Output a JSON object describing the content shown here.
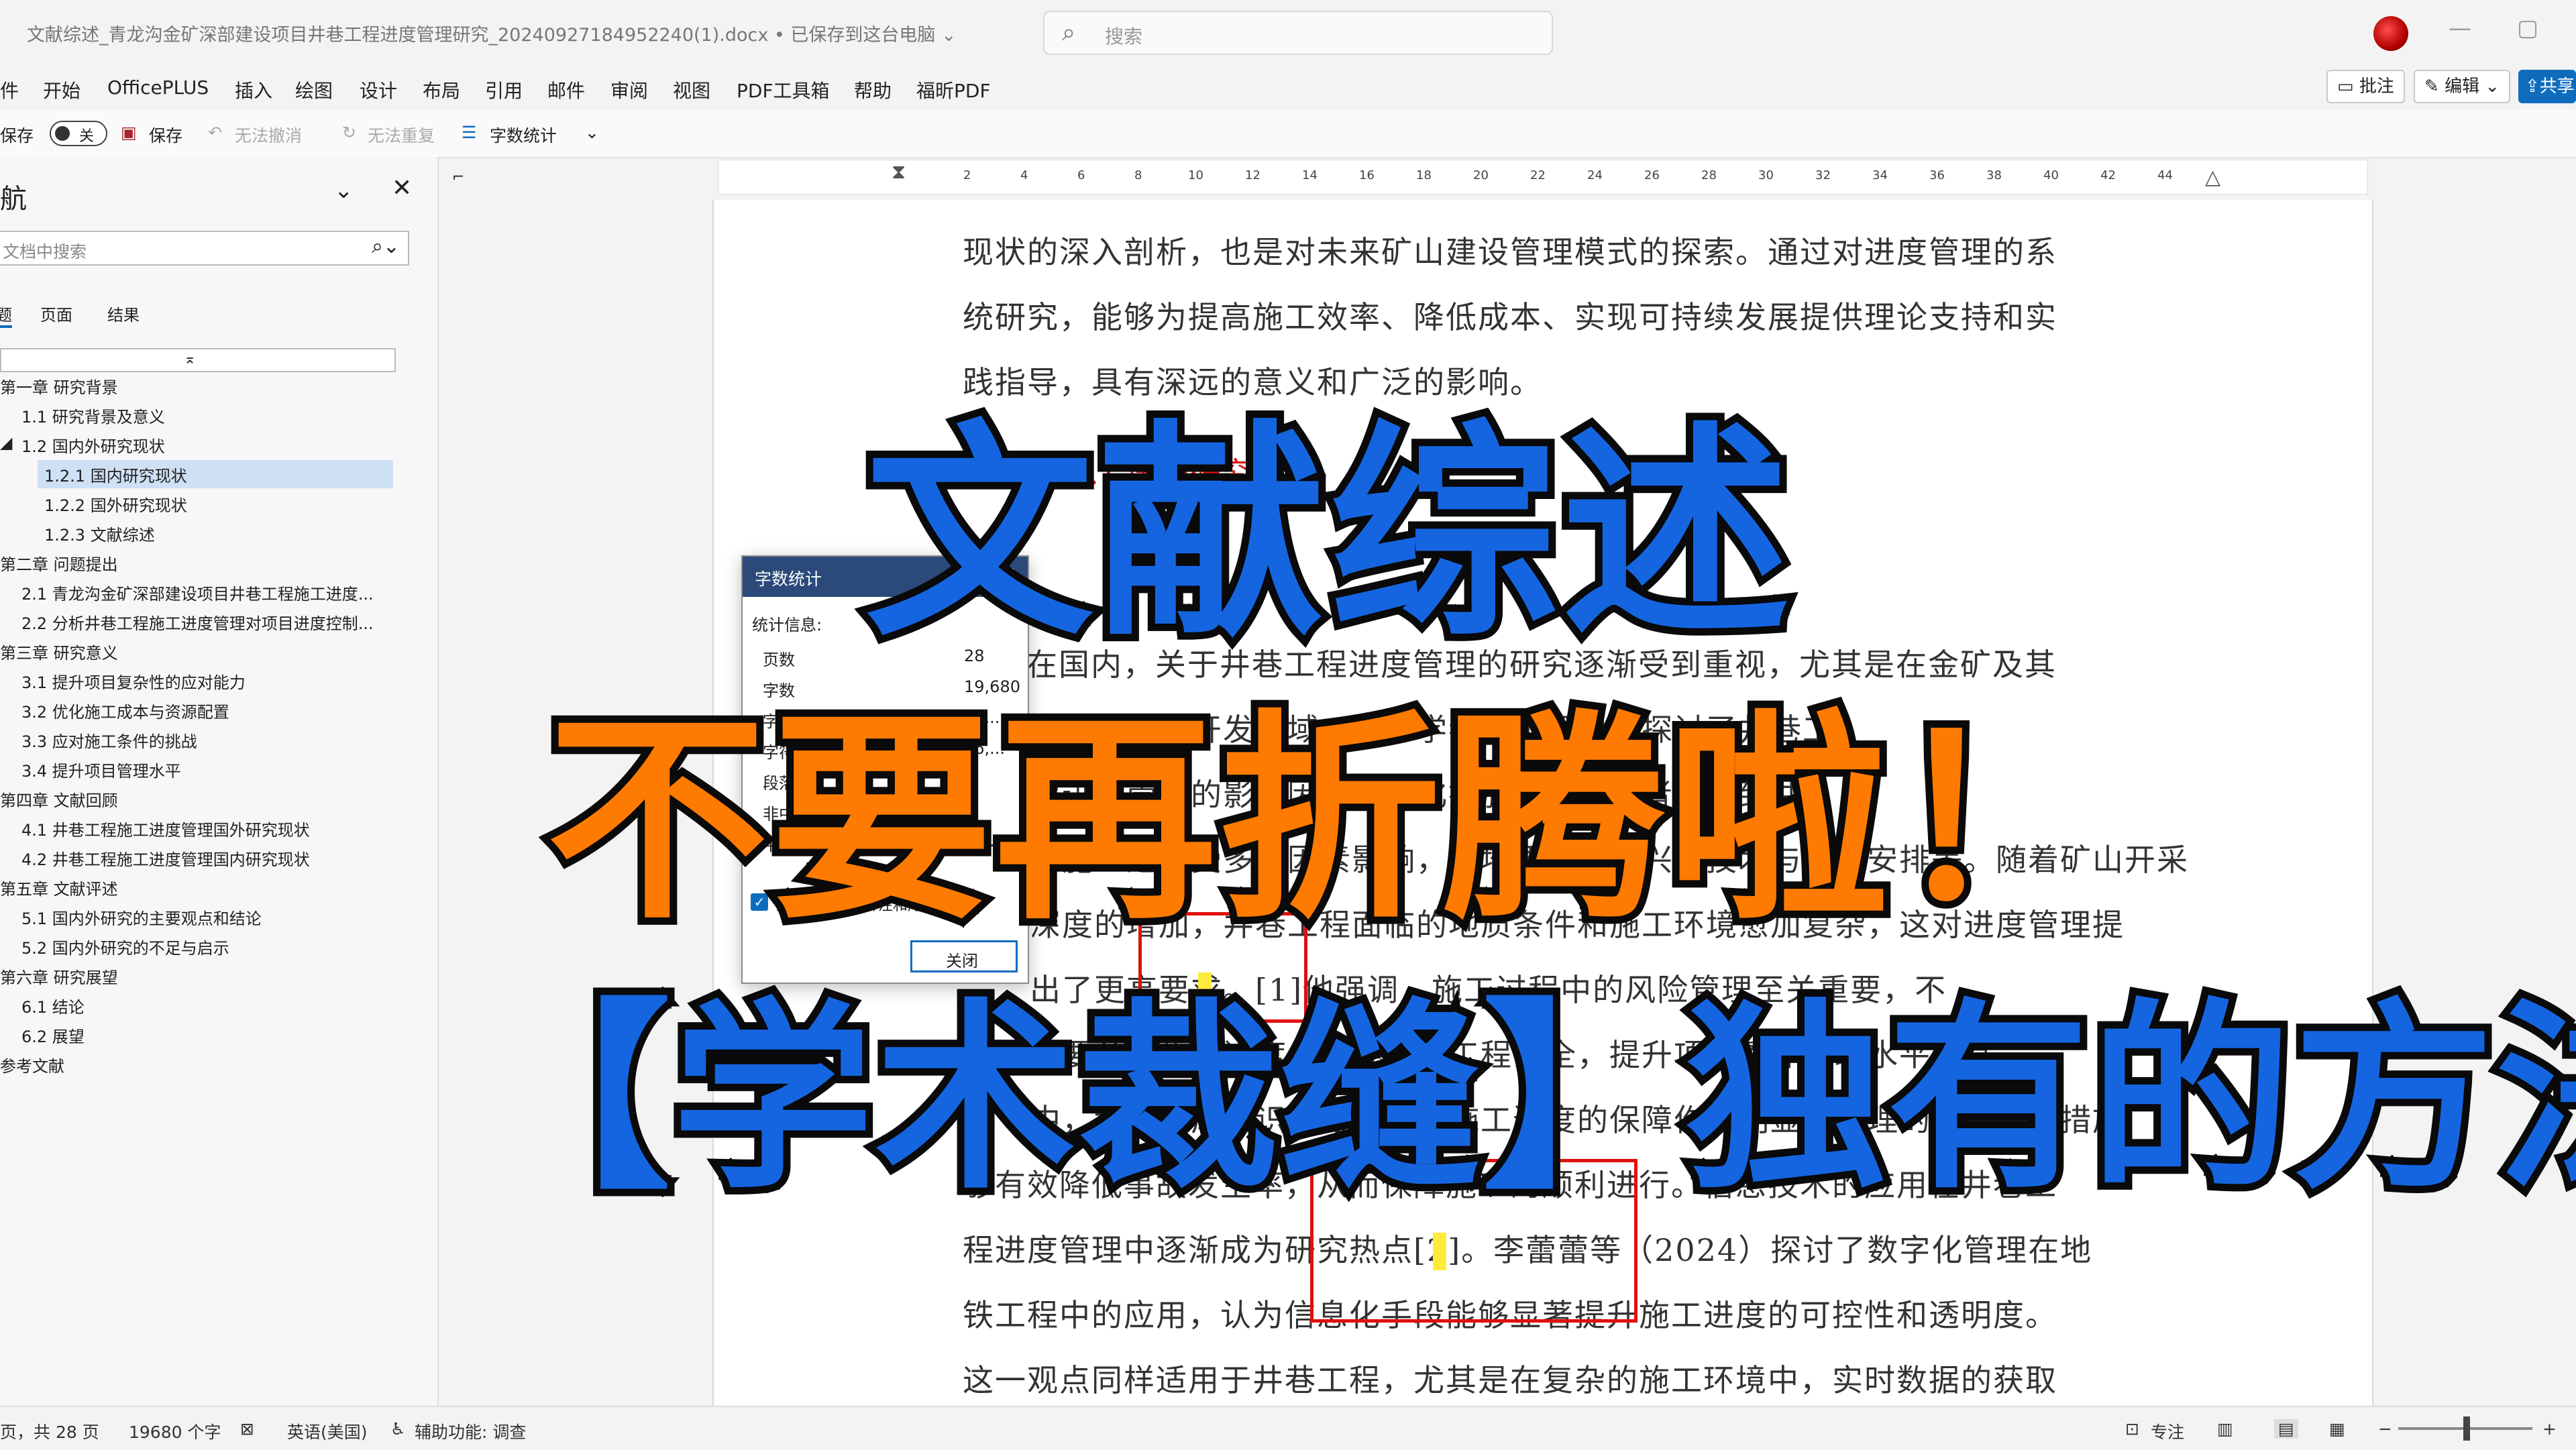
{
  "window": {
    "doc_title": "文献综述_青龙沟金矿深部建设项目井巷工程进度管理研究_20240927184952240(1).docx • 已保存到这台电脑 ⌄",
    "search_placeholder": "搜索",
    "min_icon": "minimize-icon",
    "max_icon": "maximize-icon"
  },
  "ribbon": {
    "tabs": [
      "件",
      "开始",
      "OfficePLUS",
      "插入",
      "绘图",
      "设计",
      "布局",
      "引用",
      "邮件",
      "审阅",
      "视图",
      "PDF工具箱",
      "帮助",
      "福昕PDF"
    ],
    "comment_label": "批注",
    "edit_label": "编辑 ⌄",
    "share_label": "共享"
  },
  "qat": {
    "autosave_label": "自动保存",
    "toggle_label": "关",
    "save_label": "保存",
    "undo_label": "无法撤消",
    "redo_label": "无法重复",
    "wordcount_label": "字数统计",
    "more_label": "⌄"
  },
  "nav": {
    "title": "航",
    "search_placeholder": "文档中搜索",
    "tabs": [
      "题",
      "页面",
      "结果"
    ],
    "outline": [
      "第一章 研究背景",
      "1.1 研究背景及意义",
      "1.2 国内外研究现状",
      "1.2.1 国内研究现状",
      "1.2.2 国外研究现状",
      "1.2.3 文献综述",
      "第二章 问题提出",
      "2.1 青龙沟金矿深部建设项目井巷工程施工进度...",
      "2.2 分析井巷工程施工进度管理对项目进度控制...",
      "第三章 研究意义",
      "3.1 提升项目复杂性的应对能力",
      "3.2 优化施工成本与资源配置",
      "3.3 应对施工条件的挑战",
      "3.4 提升项目管理水平",
      "第四章 文献回顾",
      "4.1 井巷工程施工进度管理国外研究现状",
      "4.2 井巷工程施工进度管理国内研究现状",
      "第五章 文献评述",
      "5.1 国内外研究的主要观点和结论",
      "5.2 国内外研究的不足与启示",
      "第六章 研究展望",
      "6.1 结论",
      "6.2 展望",
      "参考文献"
    ]
  },
  "ruler": {
    "numbers": [
      "2",
      "4",
      "6",
      "8",
      "10",
      "12",
      "14",
      "16",
      "18",
      "20",
      "22",
      "24",
      "26",
      "28",
      "30",
      "32",
      "34",
      "36",
      "38",
      "40",
      "42",
      "44"
    ]
  },
  "document": {
    "lines": [
      "现状的深入剖析，也是对未来矿山建设管理模式的探索。通过对进度管理的系",
      "统研究，能够为提高施工效率、降低成本、实现可持续发展提供理论支持和实",
      "践指导，具有深远的意义和广泛的影响。",
      "在国内，关于井巷工程进度管理的研究逐渐受到重视，尤其是在金矿及其",
      "他矿产资源开发领域。许多学者从不同角度探讨了井巷工",
      "程进度管理的影响因素与优化措施。许多学者关注到井",
      "巷施工进度受多种因素影响，如地质条件、兴建技术与人员安排等。随着矿山开采",
      "深度的增加，井巷工程面临的地质条件和施工环境愈加复杂，这对进度管理提",
      "出了更高要求。[1]他强调，施工过程中的风险管理至关重要，不",
      "仅要关注施工进度，还要确保工程安全，提升项目整体管理水平。其",
      "中，科学的风险识别与防控对施工进度的保障作用明显，合理的风险管控措施",
      "够有效降低事故发生率，从而保障施工的顺利进行。信息技术的应用在井巷工",
      "程进度管理中逐渐成为研究热点[2]。李蕾蕾等（2024）探讨了数字化管理在地",
      "铁工程中的应用，认为信息化手段能够显著提升施工进度的可控性和透明度。",
      "这一观点同样适用于井巷工程，尤其是在复杂的施工环境中，实时数据的获取"
    ],
    "heading": "1.2.1 国内研究现状"
  },
  "word_count": {
    "title": "字数统计",
    "stats_label": "统计信息:",
    "rows": [
      {
        "label": "页数",
        "value": "28"
      },
      {
        "label": "字数",
        "value": "19,680"
      },
      {
        "label": "字符数(不计空格)",
        "value": "25,..."
      },
      {
        "label": "字符数(计空格)",
        "value": "26,..."
      },
      {
        "label": "段落数",
        "value": "..."
      },
      {
        "label": "非中文单词",
        "value": "..."
      },
      {
        "label": "中文字符和朝鲜语单词",
        "value": "18,..."
      }
    ],
    "checkbox_label": "包括文本框、脚注和尾注(F)",
    "close_label": "关闭"
  },
  "overlay": {
    "line1": "文献综述",
    "line2": "不要再折腾啦！",
    "line3": "【学术裁缝】独有的方法"
  },
  "statusbar": {
    "page": "页，共 28 页",
    "words": "19680 个字",
    "lang": "英语(美国)",
    "accessibility": "辅助功能: 调查",
    "focus": "专注"
  },
  "colors": {
    "accent_blue": "#1565e0",
    "accent_orange": "#ff7a00",
    "red_box": "#e01010",
    "highlight": "#ffeb3b"
  }
}
